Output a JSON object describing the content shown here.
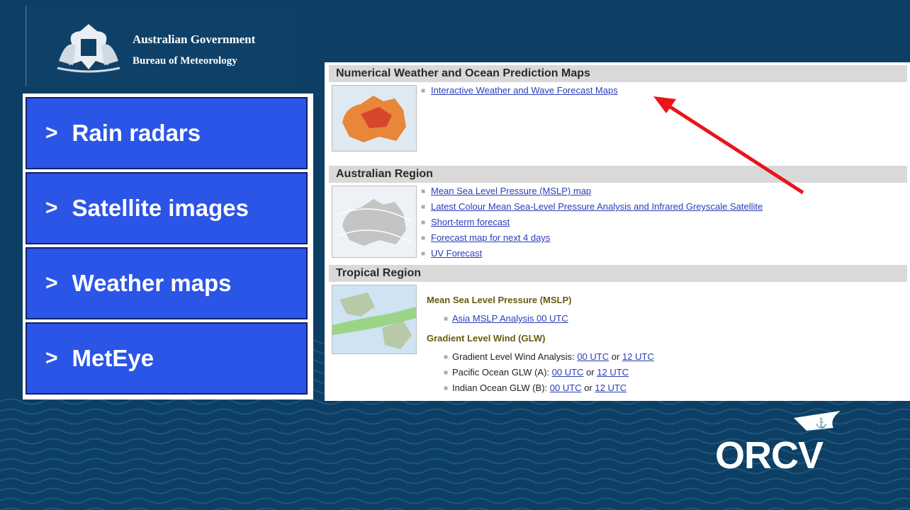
{
  "branding": {
    "gov_line": "Australian Government",
    "bureau_line": "Bureau of Meteorology",
    "orcv_logo": "ORCV"
  },
  "menu": {
    "items": [
      {
        "chevron": ">",
        "label": "Rain radars"
      },
      {
        "chevron": ">",
        "label": "Satellite images"
      },
      {
        "chevron": ">",
        "label": "Weather maps"
      },
      {
        "chevron": ">",
        "label": "MetEye"
      }
    ]
  },
  "page": {
    "sections": [
      {
        "title": "Numerical Weather and Ocean Prediction Maps",
        "links": [
          "Interactive Weather and Wave Forecast Maps"
        ]
      },
      {
        "title": "Australian Region",
        "links": [
          "Mean Sea Level Pressure (MSLP) map",
          "Latest Colour Mean Sea-Level Pressure Analysis and Infrared Greyscale Satellite",
          "Short-term forecast",
          "Forecast map for next 4 days",
          "UV Forecast"
        ]
      },
      {
        "title": "Tropical Region",
        "mslp_heading": "Mean Sea Level Pressure (MSLP)",
        "mslp_link": "Asia MSLP Analysis 00 UTC",
        "glw_heading": "Gradient Level Wind (GLW)",
        "glw_rows": [
          {
            "label": "Gradient Level Wind Analysis:",
            "a": "00 UTC",
            "or": "or",
            "b": "12 UTC"
          },
          {
            "label": "Pacific Ocean GLW (A):",
            "a": "00 UTC",
            "or": "or",
            "b": "12 UTC"
          },
          {
            "label": "Indian Ocean GLW (B):",
            "a": "00 UTC",
            "or": "or",
            "b": "12 UTC"
          }
        ]
      }
    ]
  },
  "colors": {
    "background": "#0d3f64",
    "menu_blue": "#2b55e6",
    "arrow": "#e8151b",
    "link": "#2a3db8"
  },
  "icons": {
    "crest": "coat-of-arms-icon",
    "orcv_flag": "anchor-pennant-icon",
    "bullet": "bullet-icon"
  }
}
